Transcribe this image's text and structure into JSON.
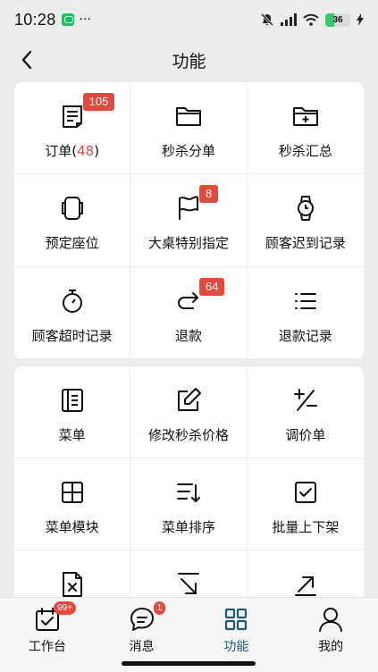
{
  "status_bar": {
    "time": "10:28",
    "dots": "···",
    "battery": "36",
    "battery_level": 0.36
  },
  "nav": {
    "title": "功能"
  },
  "section1": [
    {
      "label": "订单(",
      "count": "48",
      "suffix": ")",
      "badge": "105",
      "icon": "order-icon"
    },
    {
      "label": "秒杀分单",
      "icon": "folder-icon"
    },
    {
      "label": "秒杀汇总",
      "icon": "folder-add-icon"
    },
    {
      "label": "预定座位",
      "icon": "seat-icon"
    },
    {
      "label": "大桌特别指定",
      "badge": "8",
      "icon": "flag-icon"
    },
    {
      "label": "顾客迟到记录",
      "icon": "watch-icon"
    },
    {
      "label": "顾客超时记录",
      "icon": "stopwatch-icon"
    },
    {
      "label": "退款",
      "badge": "64",
      "icon": "redo-arrow-icon"
    },
    {
      "label": "退款记录",
      "icon": "list-icon"
    }
  ],
  "section2": [
    {
      "label": "菜单",
      "icon": "menu-book-icon"
    },
    {
      "label": "修改秒杀价格",
      "icon": "edit-icon"
    },
    {
      "label": "调价单",
      "icon": "plus-minus-icon"
    },
    {
      "label": "菜单模块",
      "icon": "grid-icon"
    },
    {
      "label": "菜单排序",
      "icon": "sort-icon"
    },
    {
      "label": "批量上下架",
      "icon": "checkbox-icon"
    },
    {
      "label": "",
      "icon": "file-x-icon"
    },
    {
      "label": "",
      "icon": "arrow-down-right-icon"
    },
    {
      "label": "",
      "icon": "arrow-up-right-icon"
    }
  ],
  "tabs": [
    {
      "label": "工作台",
      "badge": "99+",
      "icon": "workbench-icon",
      "active": false
    },
    {
      "label": "消息",
      "badge": "1",
      "icon": "message-icon",
      "active": false
    },
    {
      "label": "功能",
      "icon": "function-grid-icon",
      "active": true
    },
    {
      "label": "我的",
      "icon": "user-icon",
      "active": false
    }
  ],
  "colors": {
    "badge": "#e24a3f",
    "active_tab": "#1e5a72",
    "count": "#d9534a"
  }
}
